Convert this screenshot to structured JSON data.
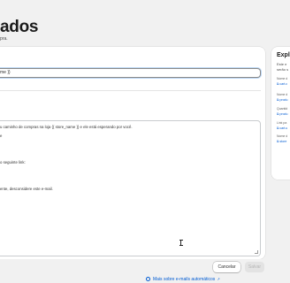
{
  "header": {
    "title": "ados",
    "subtitle": "pra."
  },
  "editor": {
    "subject_value": "me }}",
    "label_a": "",
    "label_b": "",
    "body_lines": [
      "u caminho de compras na loja {{ store_name }} e ele está esperando por você.",
      "e",
      "",
      "",
      "o seguinte link:",
      "",
      "",
      "ente, desconsidere este e-mail."
    ]
  },
  "actions": {
    "cancel_label": "Cancelar",
    "save_label": "Salvar"
  },
  "footer": {
    "link_text": "Mais sobre e-mails automáticos"
  },
  "side_panel": {
    "title": "Expl",
    "desc_lines": [
      "Este e",
      "serão s"
    ],
    "items": [
      {
        "label": "Nome d",
        "var": "cart.c"
      },
      {
        "label": "Nome d",
        "var": "produ"
      },
      {
        "label": "Quantid",
        "var": "produ"
      },
      {
        "label": "Link pa",
        "var": "cart.u"
      },
      {
        "label": "Nome d",
        "var": "store"
      }
    ]
  },
  "colors": {
    "background": "#f1f1f1",
    "card": "#ffffff",
    "link": "#005bd3",
    "focus_ring": "#bcd7f5"
  }
}
